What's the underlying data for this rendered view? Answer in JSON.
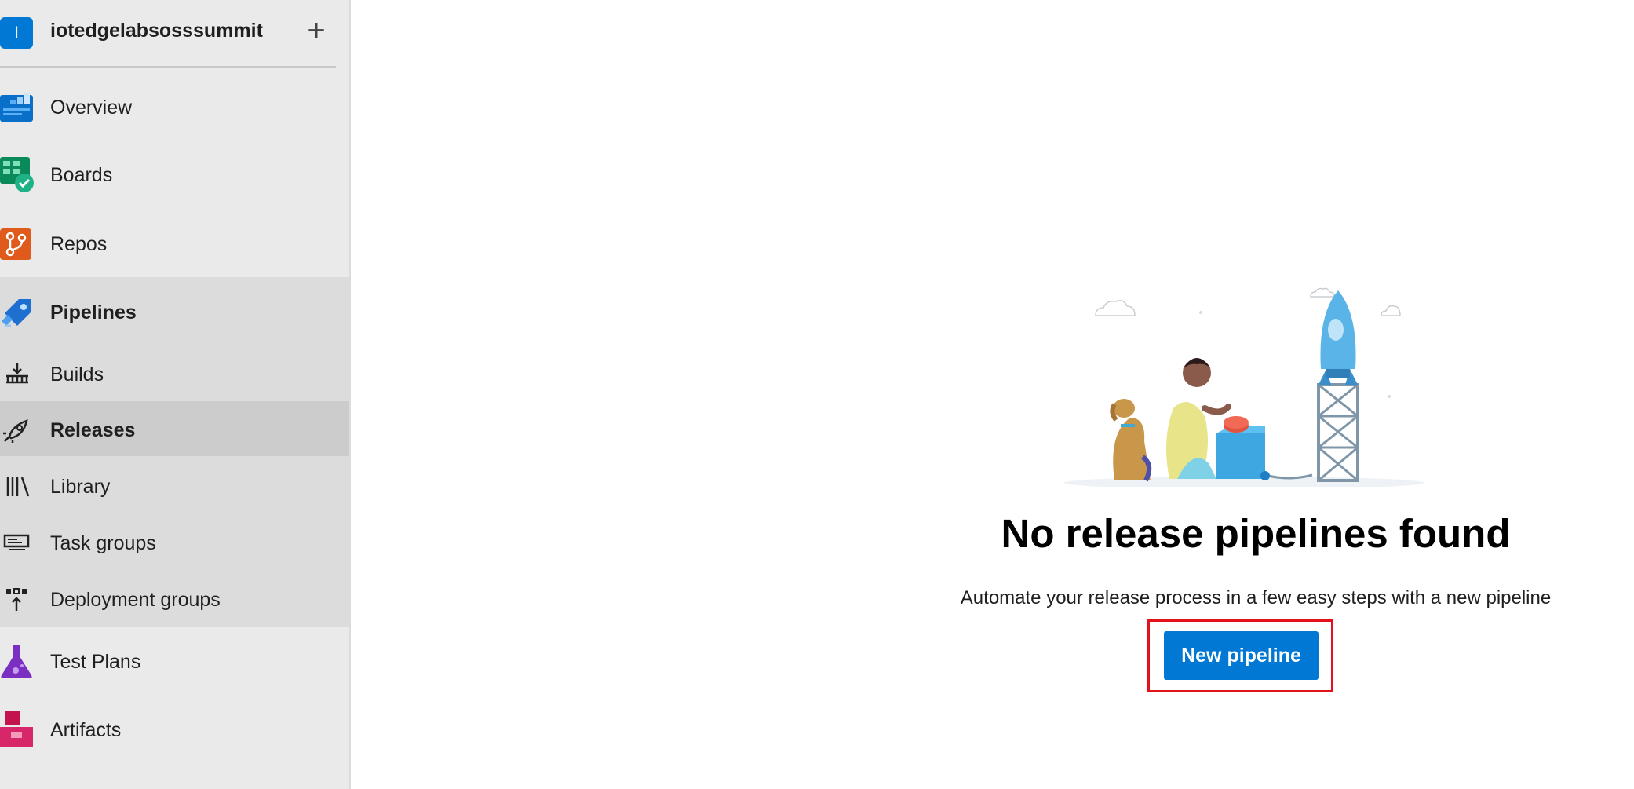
{
  "project": {
    "initial": "I",
    "name": "iotedgelabsosssummit",
    "add_symbol": "+"
  },
  "nav": {
    "overview": "Overview",
    "boards": "Boards",
    "repos": "Repos",
    "pipelines": "Pipelines",
    "builds": "Builds",
    "releases": "Releases",
    "library": "Library",
    "task_groups": "Task groups",
    "deployment_groups": "Deployment groups",
    "test_plans": "Test Plans",
    "artifacts": "Artifacts"
  },
  "empty_state": {
    "title": "No release pipelines found",
    "subtitle": "Automate your release process in a few easy steps with a new pipeline",
    "button_label": "New pipeline"
  },
  "colors": {
    "accent": "#0078d4",
    "highlight": "#e3111b",
    "sidebar_bg": "#eaeaea",
    "group_bg": "#dcdcdc",
    "selected_bg": "#cccccc"
  }
}
